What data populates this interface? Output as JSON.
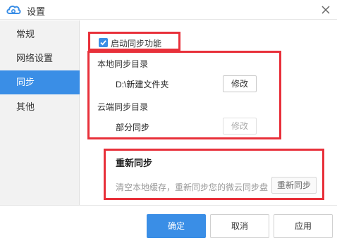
{
  "window": {
    "title": "设置"
  },
  "sidebar": {
    "items": [
      {
        "label": "常规",
        "active": false
      },
      {
        "label": "网络设置",
        "active": false
      },
      {
        "label": "同步",
        "active": true
      },
      {
        "label": "其他",
        "active": false
      }
    ]
  },
  "sync": {
    "enable_label": "启动同步功能",
    "enabled": true,
    "local_dir_label": "本地同步目录",
    "local_dir_value": "D:\\新建文件夹",
    "local_modify_btn": "修改",
    "cloud_dir_label": "云端同步目录",
    "cloud_dir_value": "部分同步",
    "cloud_modify_btn": "修改",
    "resync_title": "重新同步",
    "resync_desc": "清空本地缓存，重新同步您的微云同步盘",
    "resync_btn": "重新同步"
  },
  "footer": {
    "ok_label": "确定",
    "cancel_label": "取消",
    "apply_label": "应用"
  },
  "colors": {
    "accent": "#3a8ee6",
    "highlight": "#e8303a"
  },
  "icons": {
    "app": "cloud-icon",
    "close": "close-icon",
    "check": "checkmark-icon"
  }
}
